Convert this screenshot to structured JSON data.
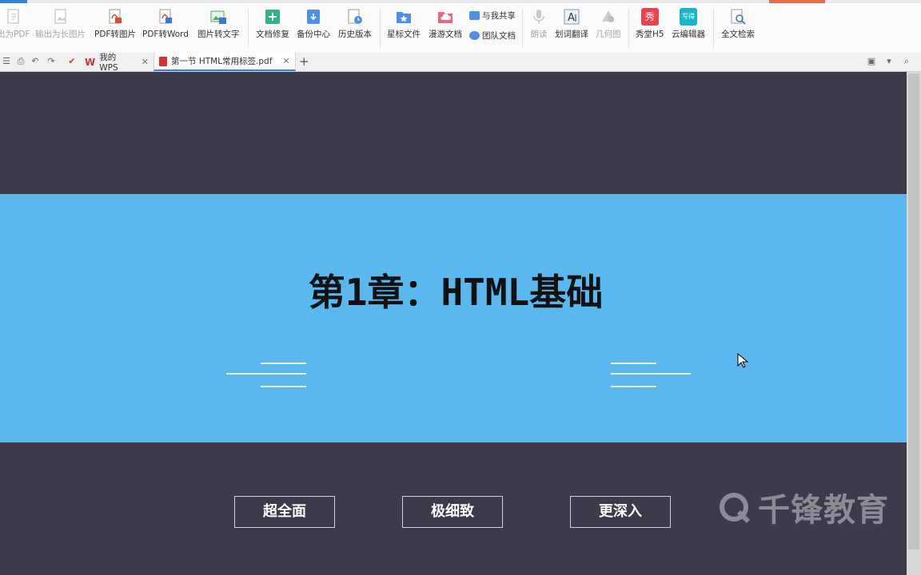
{
  "toolbar": {
    "items": [
      {
        "label": "出为PDF",
        "disabled": true
      },
      {
        "label": "输出为长图片",
        "disabled": true
      },
      {
        "label": "PDF转图片"
      },
      {
        "label": "PDF转Word"
      },
      {
        "label": "图片转文字"
      },
      {
        "label": "文档修复"
      },
      {
        "label": "备份中心"
      },
      {
        "label": "历史版本"
      },
      {
        "label": "星标文件"
      },
      {
        "label": "漫游文档"
      },
      {
        "label": "朗读",
        "disabled": true
      },
      {
        "label": "划词翻译"
      },
      {
        "label": "几何图",
        "disabled": true
      },
      {
        "label": "秀堂H5"
      },
      {
        "label": "云编辑器"
      },
      {
        "label": "全文检索"
      }
    ],
    "share_label": "与我共享",
    "team_label": "团队文档",
    "xiu_icon_text": "秀",
    "yun_icon_text": "写得"
  },
  "tabs": [
    {
      "label": "我的WPS"
    },
    {
      "label": "第一节 HTML常用标签.pdf"
    }
  ],
  "slide": {
    "title": "第1章：HTML基础",
    "buttons": [
      "超全面",
      "极细致",
      "更深入"
    ]
  },
  "watermark": {
    "text": "千锋教育"
  },
  "colors": {
    "banner": "#5ab8ee",
    "background": "#3e3a4b",
    "accent": "#2f7fe0"
  }
}
